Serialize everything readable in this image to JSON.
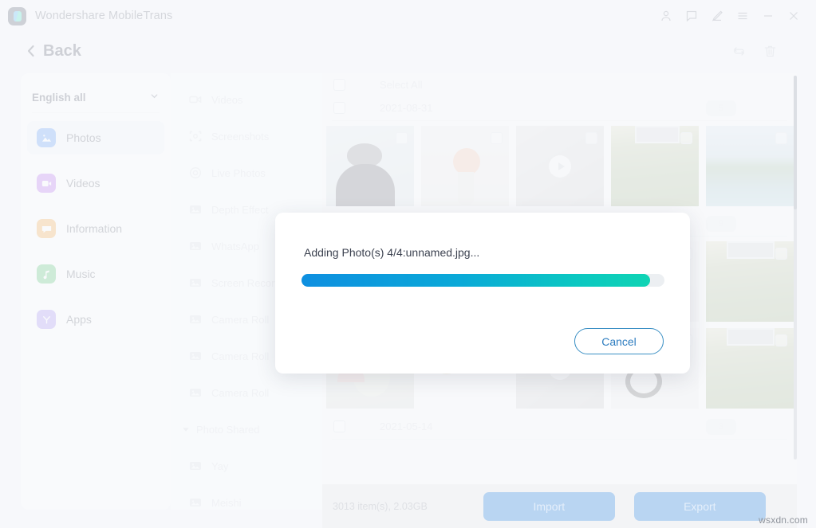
{
  "window": {
    "app_title": "Wondershare MobileTrans",
    "controls": [
      {
        "name": "account-icon",
        "label": "Account"
      },
      {
        "name": "feedback-icon",
        "label": "Feedback"
      },
      {
        "name": "edit-icon",
        "label": "Edit"
      },
      {
        "name": "menu-icon",
        "label": "Menu"
      },
      {
        "name": "minimize-icon",
        "label": "Minimize"
      },
      {
        "name": "close-icon",
        "label": "Close"
      }
    ]
  },
  "subheader": {
    "back_label": "Back",
    "tools": [
      {
        "name": "refresh-icon",
        "label": "Refresh"
      },
      {
        "name": "trash-icon",
        "label": "Delete"
      }
    ]
  },
  "sidebar": {
    "language_select": {
      "value": "English all"
    },
    "items": [
      {
        "label": "Photos",
        "icon": "photos-icon",
        "color": "#2d7ef6",
        "active": true
      },
      {
        "label": "Videos",
        "icon": "videos-icon",
        "color": "#a346e8",
        "active": false
      },
      {
        "label": "Information",
        "icon": "information-icon",
        "color": "#f39318",
        "active": false
      },
      {
        "label": "Music",
        "icon": "music-icon",
        "color": "#2cb34a",
        "active": false
      },
      {
        "label": "Apps",
        "icon": "apps-icon",
        "color": "#8b6ef0",
        "active": false
      }
    ]
  },
  "albums": {
    "items": [
      {
        "label": "Videos",
        "icon": "video-camera-icon",
        "group": false
      },
      {
        "label": "Screenshots",
        "icon": "screenshot-icon",
        "group": false
      },
      {
        "label": "Live Photos",
        "icon": "live-photo-icon",
        "group": false
      },
      {
        "label": "Depth Effect",
        "icon": "picture-icon",
        "group": false
      },
      {
        "label": "WhatsApp",
        "icon": "picture-icon",
        "group": false
      },
      {
        "label": "Screen Recorder",
        "icon": "picture-icon",
        "group": false
      },
      {
        "label": "Camera Roll",
        "icon": "picture-icon",
        "group": false
      },
      {
        "label": "Camera Roll",
        "icon": "picture-icon",
        "group": false
      },
      {
        "label": "Camera Roll",
        "icon": "picture-icon",
        "group": false
      },
      {
        "label": "Photo Shared",
        "icon": "caret-down-icon",
        "group": true
      },
      {
        "label": "Yay",
        "icon": "picture-icon",
        "group": false
      },
      {
        "label": "Meishi",
        "icon": "picture-icon",
        "group": false
      }
    ]
  },
  "main": {
    "select_all_label": "Select All",
    "date_groups": [
      {
        "date": "2021-08-31",
        "count": "5"
      },
      {
        "date": "",
        "count": "9"
      },
      {
        "date": "2021-05-14",
        "count": "3"
      }
    ]
  },
  "bottombar": {
    "count_text": "3013 item(s), 2.03GB",
    "import_label": "Import",
    "export_label": "Export"
  },
  "modal": {
    "message": "Adding Photo(s) 4/4:unnamed.jpg...",
    "progress_percent": 96,
    "cancel_label": "Cancel"
  },
  "watermark": {
    "text": "wsxdn.com"
  }
}
